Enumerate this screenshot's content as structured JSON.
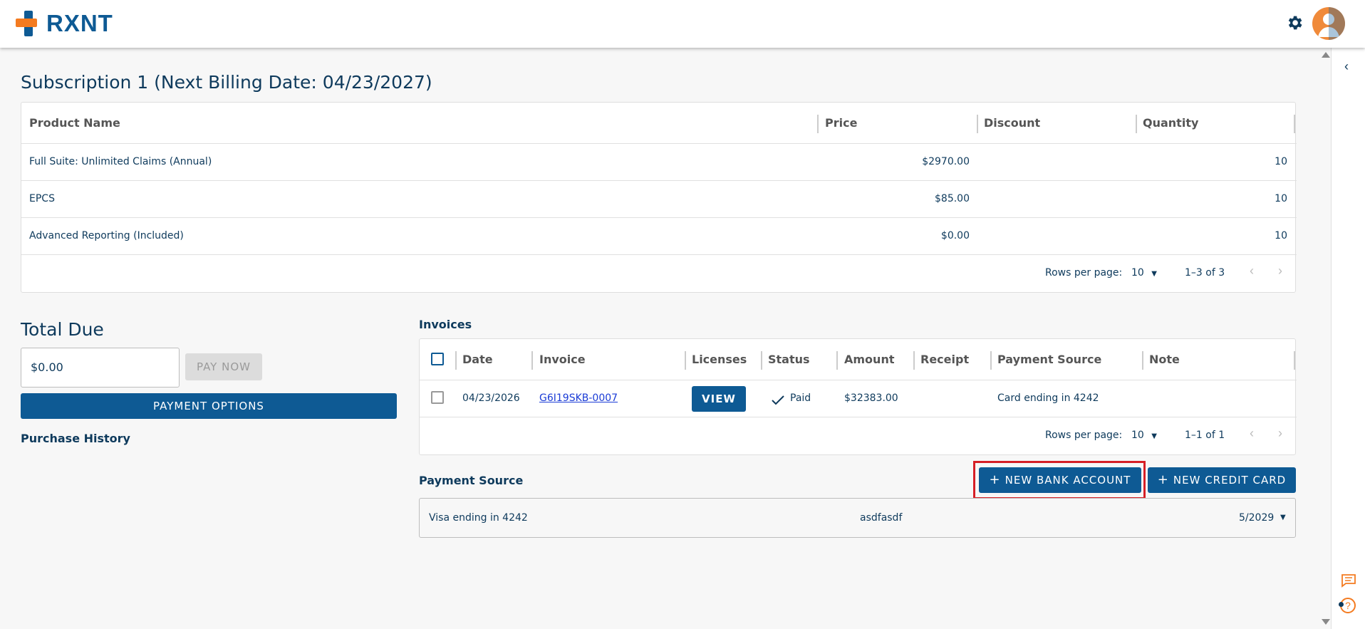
{
  "header": {
    "logo_text": "RXNT",
    "icons": [
      "settings-gear-icon",
      "user-avatar"
    ]
  },
  "subscription": {
    "title": "Subscription 1 (Next Billing Date: 04/23/2027)",
    "columns": [
      "Product Name",
      "Price",
      "Discount",
      "Quantity"
    ],
    "rows": [
      {
        "name": "Full Suite: Unlimited Claims (Annual)",
        "price": "$2970.00",
        "discount": "",
        "quantity": "10"
      },
      {
        "name": "EPCS",
        "price": "$85.00",
        "discount": "",
        "quantity": "10"
      },
      {
        "name": "Advanced Reporting (Included)",
        "price": "$0.00",
        "discount": "",
        "quantity": "10"
      }
    ],
    "pager": {
      "rows_label": "Rows per page:",
      "rows_value": "10",
      "range": "1–3 of 3"
    }
  },
  "total": {
    "heading": "Total Due",
    "amount": "$0.00",
    "pay_now": "PAY NOW",
    "payment_options": "PAYMENT OPTIONS",
    "purchase_history": "Purchase History"
  },
  "invoices": {
    "heading": "Invoices",
    "columns": [
      "Date",
      "Invoice",
      "Licenses",
      "Status",
      "Amount",
      "Receipt",
      "Payment Source",
      "Note"
    ],
    "rows": [
      {
        "date": "04/23/2026",
        "invoice": "G6I19SKB-0007",
        "licenses_btn": "VIEW",
        "status": "Paid",
        "amount": "$32383.00",
        "receipt": "",
        "payment_source": "Card ending in 4242",
        "note": ""
      }
    ],
    "pager": {
      "rows_label": "Rows per page:",
      "rows_value": "10",
      "range": "1–1 of 1"
    }
  },
  "payment_source": {
    "heading": "Payment Source",
    "new_bank": "NEW BANK ACCOUNT",
    "new_card": "NEW CREDIT CARD",
    "plus": "+",
    "card": {
      "label": "Visa ending in 4242",
      "name": "asdfasdf",
      "expiry": "5/2029"
    }
  },
  "colors": {
    "brand_blue": "#0e5a94",
    "brand_orange": "#f47b20",
    "highlight_red": "#d61f26",
    "link": "#1a3bd6"
  }
}
